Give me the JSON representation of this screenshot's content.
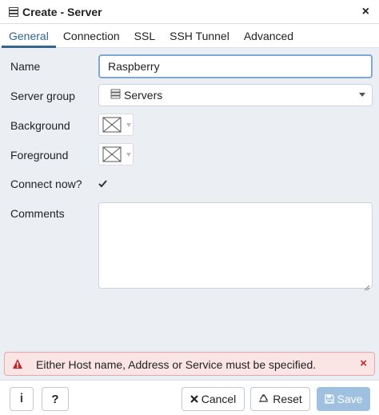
{
  "dialog": {
    "title": "Create - Server",
    "close_glyph": "×"
  },
  "tabs": [
    {
      "label": "General",
      "active": true
    },
    {
      "label": "Connection",
      "active": false
    },
    {
      "label": "SSL",
      "active": false
    },
    {
      "label": "SSH Tunnel",
      "active": false
    },
    {
      "label": "Advanced",
      "active": false
    }
  ],
  "form": {
    "name_label": "Name",
    "name_value": "Raspberry",
    "server_group_label": "Server group",
    "server_group_value": "Servers",
    "background_label": "Background",
    "foreground_label": "Foreground",
    "connect_now_label": "Connect now?",
    "connect_now_checked": true,
    "comments_label": "Comments",
    "comments_value": ""
  },
  "error": {
    "message": "Either Host name, Address or Service must be specified.",
    "close_glyph": "×"
  },
  "footer": {
    "info_glyph": "i",
    "help_glyph": "?",
    "cancel_label": "Cancel",
    "reset_label": "Reset",
    "save_label": "Save"
  },
  "colors": {
    "accent": "#326690",
    "error_bg": "#fbe4e4",
    "error_icon": "#c0272d",
    "save_disabled": "#9fc1df"
  },
  "icons": {
    "title": "server-icon",
    "group": "server-group-icon",
    "color_swatch": "no-color-icon",
    "warning": "warning-triangle-icon",
    "cancel": "x-icon",
    "reset": "recycle-icon",
    "save": "floppy-disk-icon"
  }
}
